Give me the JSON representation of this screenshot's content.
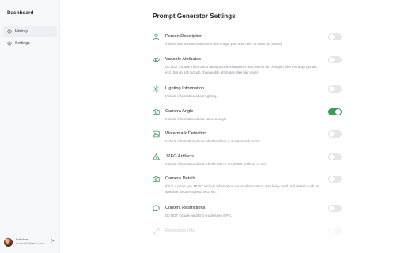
{
  "sidebar": {
    "brand": "Dashboard",
    "items": [
      {
        "label": "History",
        "icon": "history-icon",
        "active": true
      },
      {
        "label": "Settings",
        "icon": "gear-icon",
        "active": false
      }
    ],
    "user": {
      "name": "Bob Hoar",
      "email": "hoarbob99@gmail.com"
    }
  },
  "main": {
    "title": "Prompt Generator Settings",
    "settings": [
      {
        "label": "Person Description",
        "description": "If there is a person/character in the image you must refer to them as {name}.",
        "icon": "person-icon",
        "enabled": false
      },
      {
        "label": "Variable Attributes",
        "description": "Do NOT include information about people/characters that cannot be changed (like ethnicity, gender, etc), but do still include changeable attributes (like hair style).",
        "icon": "eye-icon",
        "enabled": false
      },
      {
        "label": "Lighting Information",
        "description": "Include information about lighting.",
        "icon": "sun-icon",
        "enabled": false
      },
      {
        "label": "Camera Angle",
        "description": "Include information about camera angle.",
        "icon": "camera-icon",
        "enabled": true
      },
      {
        "label": "Watermark Detection",
        "description": "Include information about whether there is a watermark or not.",
        "icon": "image-icon",
        "enabled": false
      },
      {
        "label": "JPEG Artifacts",
        "description": "Include information about whether there are JPEG artifacts or not.",
        "icon": "warning-icon",
        "enabled": false
      },
      {
        "label": "Camera Details",
        "description": "If it is a photo you MUST include information about what camera was likely used and details such as aperture, shutter speed, ISO, etc.",
        "icon": "camera-icon",
        "enabled": false
      },
      {
        "label": "Content Restrictions",
        "description": "Do NOT include anything crude keep it PG.",
        "icon": "chat-icon",
        "enabled": false
      },
      {
        "label": "Resolution Info",
        "description": "",
        "icon": "expand-icon",
        "enabled": false
      }
    ]
  },
  "colors": {
    "accent": "#3d9a5b",
    "toggle_off": "#e4e6ea",
    "sidebar_bg": "#f7f8fa"
  }
}
